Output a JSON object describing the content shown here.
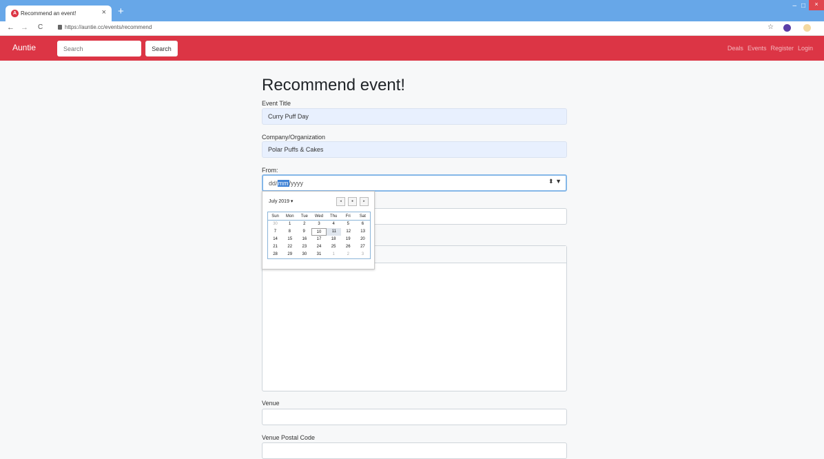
{
  "browser": {
    "tab_title": "Recommend an event!",
    "tab_close": "×",
    "new_tab": "+",
    "url": "https://auntie.cc/events/recommend",
    "win_minimize": "–",
    "win_maximize": "□",
    "win_close": "×",
    "accent": "#67a7e8"
  },
  "navbar": {
    "brand": "Auntie",
    "search_placeholder": "Search",
    "search_button": "Search",
    "links": [
      "Deals",
      "Events",
      "Register",
      "Login"
    ],
    "color": "#dc3545"
  },
  "form": {
    "title": "Recommend event!",
    "event_title_label": "Event Title",
    "event_title_value": "Curry Puff Day",
    "company_label": "Company/Organization",
    "company_value": "Polar Puffs & Cakes",
    "from_label": "From:",
    "from_dd": "dd/",
    "from_mm": "mm",
    "from_yyyy": "/yyyy",
    "from_spin": "⬍ ▼",
    "venue_label": "Venue",
    "postal_label": "Venue Postal Code"
  },
  "calendar": {
    "month": "July 2019 ▾",
    "nav_prev": "◂",
    "nav_today": "●",
    "nav_next": "▸",
    "weekdays": [
      "Sun",
      "Mon",
      "Tue",
      "Wed",
      "Thu",
      "Fri",
      "Sat"
    ],
    "weeks": [
      [
        "30",
        "1",
        "2",
        "3",
        "4",
        "5",
        "6"
      ],
      [
        "7",
        "8",
        "9",
        "10",
        "11",
        "12",
        "13"
      ],
      [
        "14",
        "15",
        "16",
        "17",
        "18",
        "19",
        "20"
      ],
      [
        "21",
        "22",
        "23",
        "24",
        "25",
        "26",
        "27"
      ],
      [
        "28",
        "29",
        "30",
        "31",
        "1",
        "2",
        "3"
      ]
    ]
  }
}
